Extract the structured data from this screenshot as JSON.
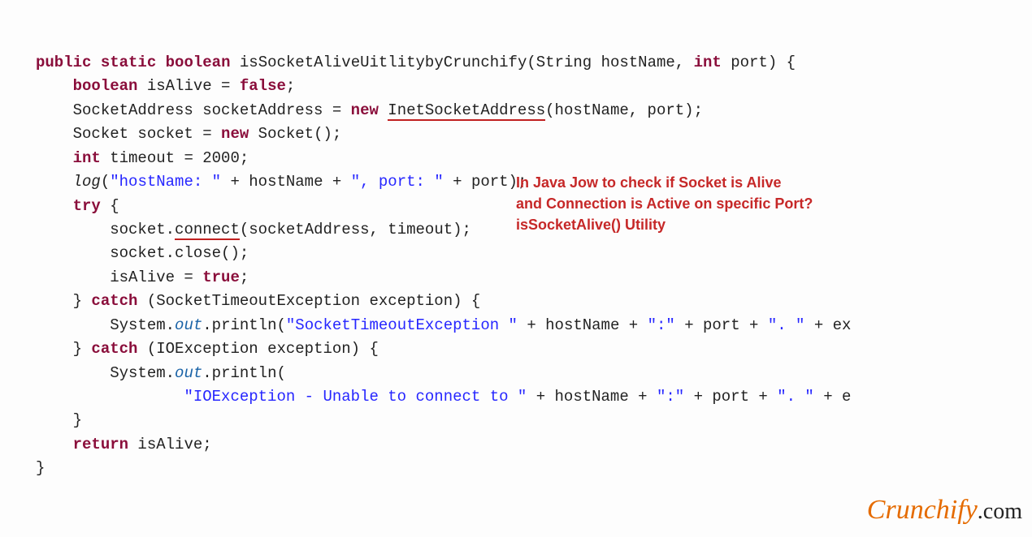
{
  "code": {
    "l1": {
      "kw1": "public",
      "kw2": "static",
      "kw3": "boolean",
      "name": "isSocketAliveUitlitybyCrunchify",
      "p1": "(String hostName, ",
      "kw4": "int",
      "p2": " port) {"
    },
    "l2": {
      "kw": "boolean",
      "rest": " isAlive = ",
      "kw2": "false",
      "semi": ";"
    },
    "l3": {
      "decl": "SocketAddress socketAddress = ",
      "kw": "new",
      "ctor": "InetSocketAddress",
      "args": "(hostName, port);"
    },
    "l4": {
      "decl": "Socket socket = ",
      "kw": "new",
      "ctor": " Socket();"
    },
    "l5": {
      "kw": "int",
      "rest": " timeout = 2000;"
    },
    "l6": {
      "fn": "log",
      "open": "(",
      "s1": "\"hostName: \"",
      "mid": " + hostName + ",
      "s2": "\", port: \"",
      "end": " + port);"
    },
    "l7": {
      "kw": "try",
      "brace": " {"
    },
    "l8": {
      "obj": "socket.",
      "fn": "connect",
      "args": "(socketAddress, timeout);"
    },
    "l9": "socket.close();",
    "l10": {
      "lhs": "isAlive = ",
      "kw": "true",
      "semi": ";"
    },
    "l11": {
      "close": "} ",
      "kw": "catch",
      "args": " (SocketTimeoutException exception) {"
    },
    "l12": {
      "pre": "System.",
      "out": "out",
      "mid": ".println(",
      "s1": "\"SocketTimeoutException \"",
      "mid2": " + hostName + ",
      "s2": "\":\"",
      "mid3": " + port + ",
      "s3": "\". \"",
      "end": " + ex"
    },
    "l13": {
      "close": "} ",
      "kw": "catch",
      "args": " (IOException exception) {"
    },
    "l14": {
      "pre": "System.",
      "out": "out",
      "end": ".println("
    },
    "l15": {
      "s1": "\"IOException - Unable to connect to \"",
      "mid": " + hostName + ",
      "s2": "\":\"",
      "mid2": " + port + ",
      "s3": "\". \"",
      "end": " + e"
    },
    "l16": "}",
    "l17": {
      "kw": "return",
      "rest": " isAlive;"
    },
    "l18": "}"
  },
  "annotation": {
    "line1": "In Java Jow to check if Socket is Alive",
    "line2": "and Connection is Active on specific Port?",
    "line3": "isSocketAlive() Utility"
  },
  "brand": {
    "script": "Crunchify",
    "dotcom": ".com"
  }
}
